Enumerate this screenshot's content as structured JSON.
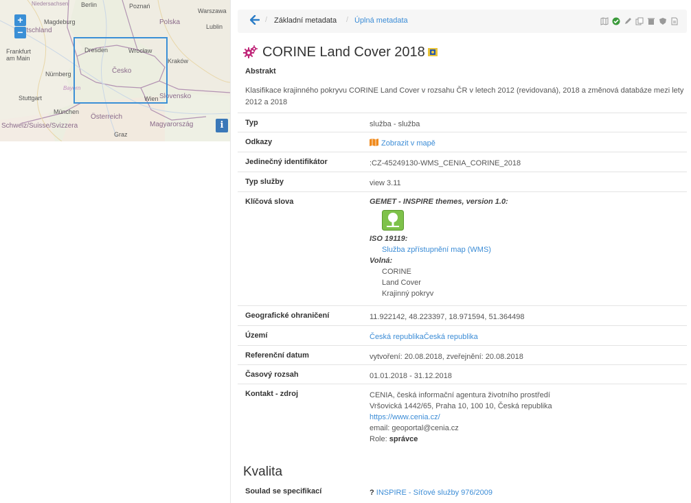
{
  "map": {
    "zoom_in": "+",
    "zoom_out": "−",
    "info": "i",
    "labels": [
      {
        "text": "Niedersachsen",
        "cls": "place"
      },
      {
        "text": "Berlin",
        "cls": "place"
      },
      {
        "text": "Poznań",
        "cls": "place"
      },
      {
        "text": "Polska",
        "cls": "country"
      },
      {
        "text": "Warszawa",
        "cls": "place"
      },
      {
        "text": "Magdeburg",
        "cls": "place"
      },
      {
        "text": "Lublin",
        "cls": "place"
      },
      {
        "text": "Deutschland",
        "cls": "country"
      },
      {
        "text": "Frankfurt am Main",
        "cls": "place"
      },
      {
        "text": "Dresden",
        "cls": "place"
      },
      {
        "text": "Wrocław",
        "cls": "place"
      },
      {
        "text": "Kraków",
        "cls": "place"
      },
      {
        "text": "Nürnberg",
        "cls": "place"
      },
      {
        "text": "Česko",
        "cls": "country"
      },
      {
        "text": "Bayern",
        "cls": "place"
      },
      {
        "text": "Stuttgart",
        "cls": "place"
      },
      {
        "text": "Slovensko",
        "cls": "country"
      },
      {
        "text": "Wien",
        "cls": "place"
      },
      {
        "text": "München",
        "cls": "place"
      },
      {
        "text": "Österreich",
        "cls": "country"
      },
      {
        "text": "Magyarország",
        "cls": "country"
      },
      {
        "text": "Schweiz/Suisse/Svizzera",
        "cls": "country"
      },
      {
        "text": "Graz",
        "cls": "place"
      }
    ]
  },
  "toolbar": {
    "breadcrumb": [
      "Základní metadata",
      "Úplná metadata"
    ],
    "icons": [
      "map-icon",
      "check-icon",
      "pencil-icon",
      "copy-icon",
      "trash-icon",
      "shield-icon",
      "pdf-icon"
    ]
  },
  "record": {
    "title": "CORINE Land Cover 2018",
    "abstract_label": "Abstrakt",
    "abstract": "Klasifikace krajinného pokryvu CORINE Land Cover v rozsahu ČR v letech 2012 (revidovaná), 2018 a změnová databáze mezi lety 2012 a 2018"
  },
  "fields": {
    "typ": {
      "label": "Typ",
      "value": "služba - služba"
    },
    "odkazy": {
      "label": "Odkazy",
      "value": "Zobrazit v mapě"
    },
    "identifikator": {
      "label": "Jedinečný identifikátor",
      "value": ":CZ-45249130-WMS_CENIA_CORINE_2018"
    },
    "typ_sluzby": {
      "label": "Typ služby",
      "value": "view 3.11"
    },
    "klicova_slova": {
      "label": "Klíčová slova",
      "gemet": "GEMET - INSPIRE themes, version 1.0:",
      "iso": "ISO 19119:",
      "iso_item": "Služba zpřístupnění map (WMS)",
      "volna": "Volná:",
      "volna_items": [
        "CORINE",
        "Land Cover",
        "Krajinný pokryv"
      ]
    },
    "geo": {
      "label": "Geografické ohraničení",
      "value": "11.922142, 48.223397, 18.971594, 51.364498"
    },
    "uzemi": {
      "label": "Území",
      "value": "Česká republikaČeská republika"
    },
    "ref_datum": {
      "label": "Referenční datum",
      "value": "vytvoření: 20.08.2018, zveřejnění: 20.08.2018"
    },
    "casovy_rozsah": {
      "label": "Časový rozsah",
      "value": "01.01.2018 - 31.12.2018"
    },
    "kontakt": {
      "label": "Kontakt - zdroj",
      "org": "CENIA, česká informační agentura životního prostředí",
      "address": "Vršovická 1442/65, Praha 10, 100 10, Česká republika",
      "url": "https://www.cenia.cz/",
      "email": "email: geoportal@cenia.cz",
      "role_label": "Role:",
      "role_value": "správce"
    }
  },
  "kvalita": {
    "title": "Kvalita",
    "soulad_label": "Soulad se specifikací",
    "soulad_prefix": "?",
    "soulad_value": "INSPIRE - Síťové služby 976/2009"
  }
}
